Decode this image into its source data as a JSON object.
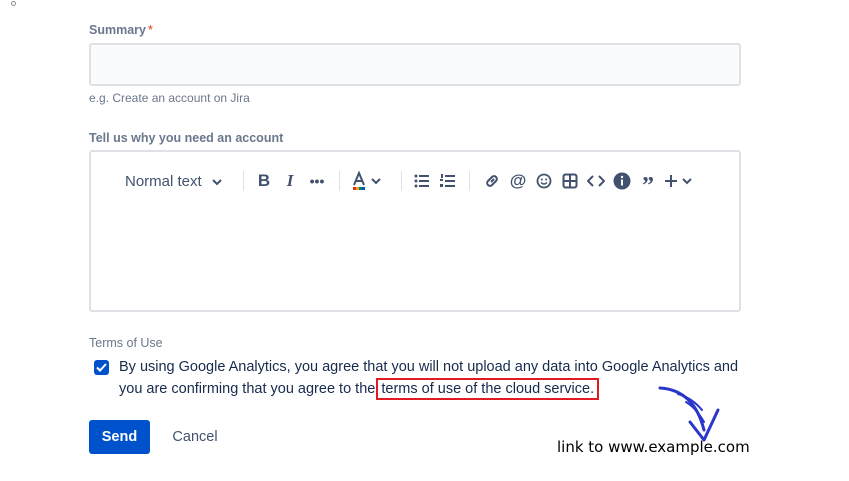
{
  "form": {
    "summary_label": "Summary",
    "required_mark": "*",
    "summary_value": "",
    "summary_helper": "e.g. Create an account on Jira",
    "reason_label": "Tell us why you need an account",
    "reason_value": "",
    "terms_heading": "Terms of Use",
    "terms_checked": true,
    "terms_text_before": "By using Google Analytics, you agree that you will not upload any data into Google Analytics and you are confirming that you agree to the ",
    "terms_link_text": "terms of use of the cloud service.",
    "send_label": "Send",
    "cancel_label": "Cancel"
  },
  "editor_toolbar": {
    "text_style": "Normal text",
    "icons": [
      "chevron-down-icon",
      "bold-icon",
      "italic-icon",
      "more-icon",
      "text-color-icon",
      "bullet-list-icon",
      "numbered-list-icon",
      "link-icon",
      "mention-icon",
      "emoji-icon",
      "table-icon",
      "code-icon",
      "info-icon",
      "quote-icon",
      "insert-icon"
    ]
  },
  "annotation": {
    "text": "link to www.example.com",
    "highlight_color": "#e01b24",
    "arrow_color": "#2a36c9"
  },
  "colors": {
    "primary": "#0052cc",
    "label": "#6b778c",
    "text": "#172b4d"
  }
}
